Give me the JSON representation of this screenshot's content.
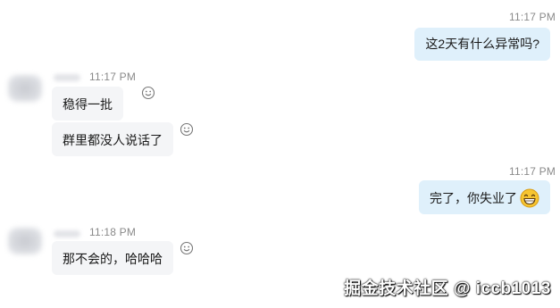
{
  "messages": [
    {
      "direction": "outgoing",
      "time": "11:17 PM",
      "text": "这2天有什么异常吗?"
    },
    {
      "direction": "incoming",
      "time": "11:17 PM",
      "text": "稳得一批"
    },
    {
      "direction": "incoming",
      "time": "",
      "text": "群里都没人说话了"
    },
    {
      "direction": "outgoing",
      "time": "11:17 PM",
      "text": "完了，你失业了",
      "emoji": "grin-icon"
    },
    {
      "direction": "incoming",
      "time": "11:18 PM",
      "text": "那不会的，哈哈哈"
    }
  ],
  "reaction_icon": "smiley-outline-icon",
  "watermark": "掘金技术社区 @ iccb1013",
  "colors": {
    "outgoing_bubble": "#dff0fb",
    "incoming_bubble": "#f4f5f7",
    "timestamp": "#8a8a8a",
    "emoji_yellow": "#f7c531"
  }
}
